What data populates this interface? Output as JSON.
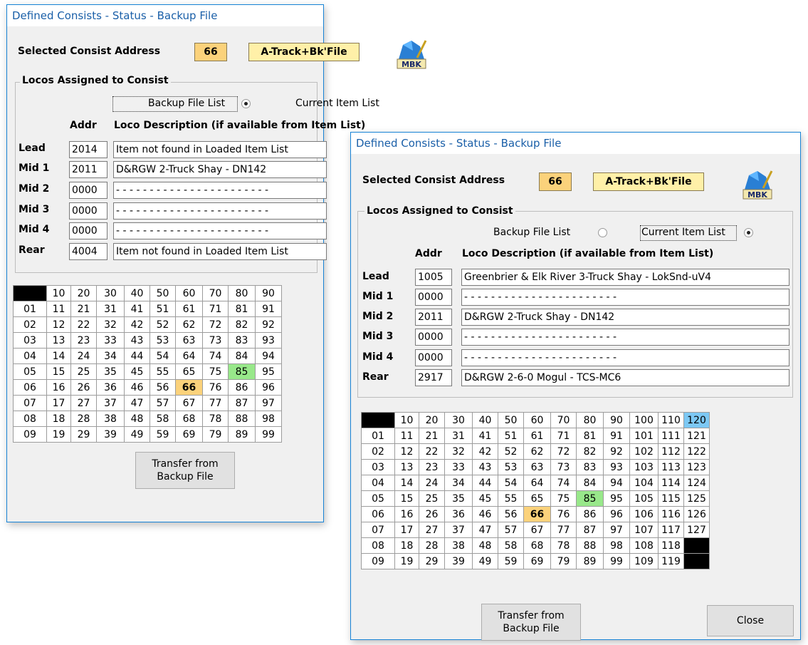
{
  "windows": [
    {
      "title": "Defined Consists - Status - Backup File",
      "selected_label": "Selected Consist Address",
      "address": "66",
      "source": "A-Track+Bk'File",
      "icon_text": "MBK",
      "group_label": "Locos Assigned to Consist",
      "radio_backup_label": "Backup File List",
      "radio_current_label": "Current Item List",
      "radio_selected": "backup",
      "addr_header": "Addr",
      "desc_header": "Loco Description (if available from Item List)",
      "rows": [
        {
          "label": "Lead",
          "addr": "2014",
          "desc": "Item not found in Loaded Item List"
        },
        {
          "label": "Mid 1",
          "addr": "2011",
          "desc": "D&RGW 2-Truck Shay - DN142"
        },
        {
          "label": "Mid 2",
          "addr": "0000",
          "desc": "- - - - - - - - - - - - - - - - - - - - - - -"
        },
        {
          "label": "Mid 3",
          "addr": "0000",
          "desc": "- - - - - - - - - - - - - - - - - - - - - - -"
        },
        {
          "label": "Mid 4",
          "addr": "0000",
          "desc": "- - - - - - - - - - - - - - - - - - - - - - -"
        },
        {
          "label": "Rear",
          "addr": "4004",
          "desc": "Item not found in Loaded Item List"
        }
      ],
      "grid": [
        [
          "",
          "10",
          "20",
          "30",
          "40",
          "50",
          "60",
          "70",
          "80",
          "90"
        ],
        [
          "01",
          "11",
          "21",
          "31",
          "41",
          "51",
          "61",
          "71",
          "81",
          "91"
        ],
        [
          "02",
          "12",
          "22",
          "32",
          "42",
          "52",
          "62",
          "72",
          "82",
          "92"
        ],
        [
          "03",
          "13",
          "23",
          "33",
          "43",
          "53",
          "63",
          "73",
          "83",
          "93"
        ],
        [
          "04",
          "14",
          "24",
          "34",
          "44",
          "54",
          "64",
          "74",
          "84",
          "94"
        ],
        [
          "05",
          "15",
          "25",
          "35",
          "45",
          "55",
          "65",
          "75",
          "85",
          "95"
        ],
        [
          "06",
          "16",
          "26",
          "36",
          "46",
          "56",
          "66",
          "76",
          "86",
          "96"
        ],
        [
          "07",
          "17",
          "27",
          "37",
          "47",
          "57",
          "67",
          "77",
          "87",
          "97"
        ],
        [
          "08",
          "18",
          "28",
          "38",
          "48",
          "58",
          "68",
          "78",
          "88",
          "98"
        ],
        [
          "09",
          "19",
          "29",
          "39",
          "49",
          "59",
          "69",
          "79",
          "89",
          "99"
        ]
      ],
      "transfer_label_1": "Transfer from",
      "transfer_label_2": "Backup File"
    },
    {
      "title": "Defined Consists - Status - Backup File",
      "selected_label": "Selected Consist Address",
      "address": "66",
      "source": "A-Track+Bk'File",
      "icon_text": "MBK",
      "group_label": "Locos Assigned to Consist",
      "radio_backup_label": "Backup File List",
      "radio_current_label": "Current Item List",
      "radio_selected": "current",
      "addr_header": "Addr",
      "desc_header": "Loco Description (if available from Item List)",
      "rows": [
        {
          "label": "Lead",
          "addr": "1005",
          "desc": "Greenbrier & Elk River 3-Truck Shay - LokSnd-uV4"
        },
        {
          "label": "Mid 1",
          "addr": "0000",
          "desc": "- - - - - - - - - - - - - - - - - - - - - - -"
        },
        {
          "label": "Mid 2",
          "addr": "2011",
          "desc": "D&RGW 2-Truck Shay - DN142"
        },
        {
          "label": "Mid 3",
          "addr": "0000",
          "desc": "- - - - - - - - - - - - - - - - - - - - - - -"
        },
        {
          "label": "Mid 4",
          "addr": "0000",
          "desc": "- - - - - - - - - - - - - - - - - - - - - - -"
        },
        {
          "label": "Rear",
          "addr": "2917",
          "desc": "D&RGW 2-6-0 Mogul - TCS-MC6"
        }
      ],
      "grid": [
        [
          "",
          "10",
          "20",
          "30",
          "40",
          "50",
          "60",
          "70",
          "80",
          "90",
          "100",
          "110",
          "120"
        ],
        [
          "01",
          "11",
          "21",
          "31",
          "41",
          "51",
          "61",
          "71",
          "81",
          "91",
          "101",
          "111",
          "121"
        ],
        [
          "02",
          "12",
          "22",
          "32",
          "42",
          "52",
          "62",
          "72",
          "82",
          "92",
          "102",
          "112",
          "122"
        ],
        [
          "03",
          "13",
          "23",
          "33",
          "43",
          "53",
          "63",
          "73",
          "83",
          "93",
          "103",
          "113",
          "123"
        ],
        [
          "04",
          "14",
          "24",
          "34",
          "44",
          "54",
          "64",
          "74",
          "84",
          "94",
          "104",
          "114",
          "124"
        ],
        [
          "05",
          "15",
          "25",
          "35",
          "45",
          "55",
          "65",
          "75",
          "85",
          "95",
          "105",
          "115",
          "125"
        ],
        [
          "06",
          "16",
          "26",
          "36",
          "46",
          "56",
          "66",
          "76",
          "86",
          "96",
          "106",
          "116",
          "126"
        ],
        [
          "07",
          "17",
          "27",
          "37",
          "47",
          "57",
          "67",
          "77",
          "87",
          "97",
          "107",
          "117",
          "127"
        ],
        [
          "08",
          "18",
          "28",
          "38",
          "48",
          "58",
          "68",
          "78",
          "88",
          "98",
          "108",
          "118",
          ""
        ],
        [
          "09",
          "19",
          "29",
          "39",
          "49",
          "59",
          "69",
          "79",
          "89",
          "99",
          "109",
          "119",
          ""
        ]
      ],
      "transfer_label_1": "Transfer from",
      "transfer_label_2": "Backup File",
      "close_label": "Close"
    }
  ],
  "colors": {
    "selected_address": "#fbd27b",
    "active_address": "#98e88a",
    "highlight_address": "#7cc8f4",
    "unavailable": "#000000",
    "title_text": "#1a5fa8"
  }
}
